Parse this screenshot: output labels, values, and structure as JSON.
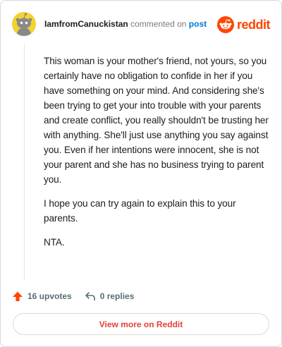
{
  "header": {
    "username": "IamfromCanuckistan",
    "commented_text": "commented on",
    "post_link": "post",
    "brand_word": "reddit"
  },
  "comment": {
    "paragraphs": [
      "This woman is your mother's friend, not yours, so you certainly have no obligation to confide in her if you have something on your mind. And considering she's been trying to get your into trouble with your parents and create conflict, you really shouldn't be trusting her with anything. She'll just use anything you say against you. Even if her intentions were innocent, she is not your parent and she has no business trying to parent you.",
      "I hope you can try again to explain this to your parents.",
      "NTA."
    ]
  },
  "actions": {
    "upvotes": "16 upvotes",
    "replies": "0 replies"
  },
  "footer": {
    "view_more": "View more on Reddit"
  },
  "colors": {
    "accent_red": "#ff4500",
    "link_blue": "#0079d3",
    "avatar_yellow": "#f3d234"
  },
  "icons": [
    "snoo-avatar-icon",
    "reddit-logo-icon",
    "upvote-arrow-icon",
    "reply-arrow-icon"
  ]
}
